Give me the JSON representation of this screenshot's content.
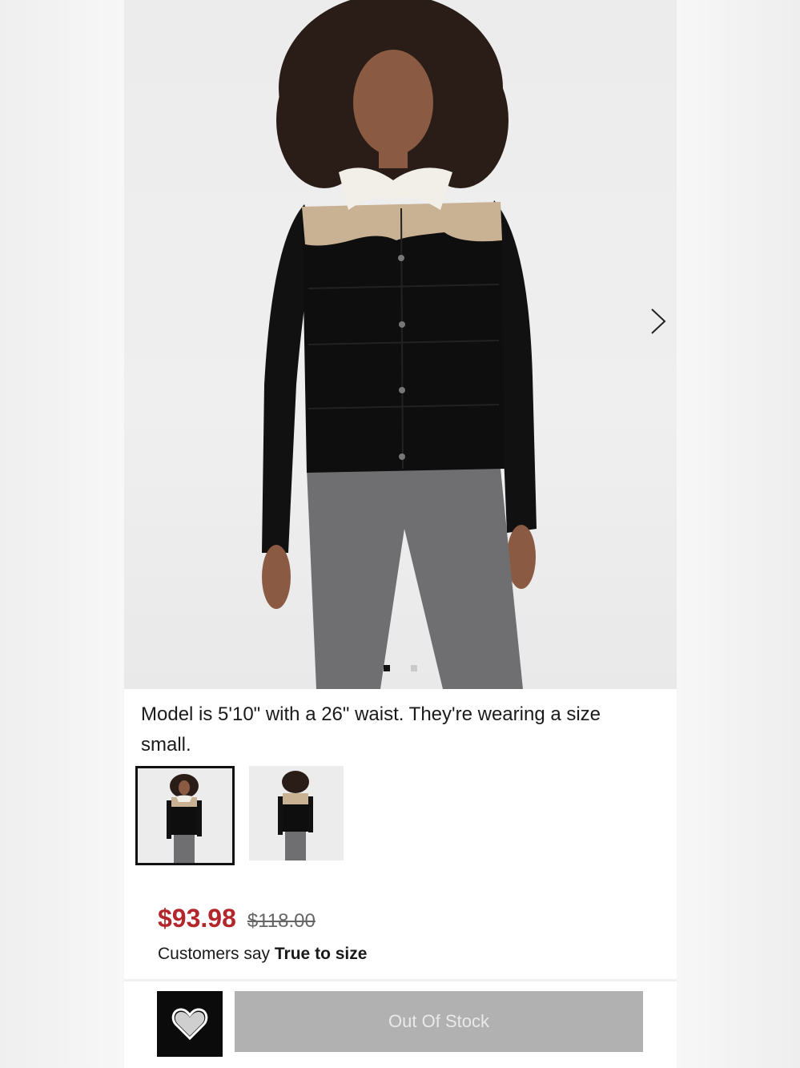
{
  "product": {
    "image_alt": "Model wearing black puffer vest with tan yoke and sherpa collar",
    "caption": "Model is 5'10\" with a 26\" waist. They're wearing a size small.",
    "gallery": {
      "active_index": 0,
      "count": 2
    },
    "thumbnails": [
      {
        "label": "front view",
        "selected": true
      },
      {
        "label": "back view",
        "selected": false
      }
    ],
    "price": {
      "sale": "$93.98",
      "original": "$118.00",
      "sale_color": "#b3262b"
    },
    "fit": {
      "prefix": "Customers say",
      "value": "True to size"
    }
  },
  "actions": {
    "wishlist_icon": "heart-icon",
    "cta_label": "Out Of Stock",
    "cta_state": "disabled"
  },
  "icons": {
    "next": "chevron-right-icon"
  }
}
